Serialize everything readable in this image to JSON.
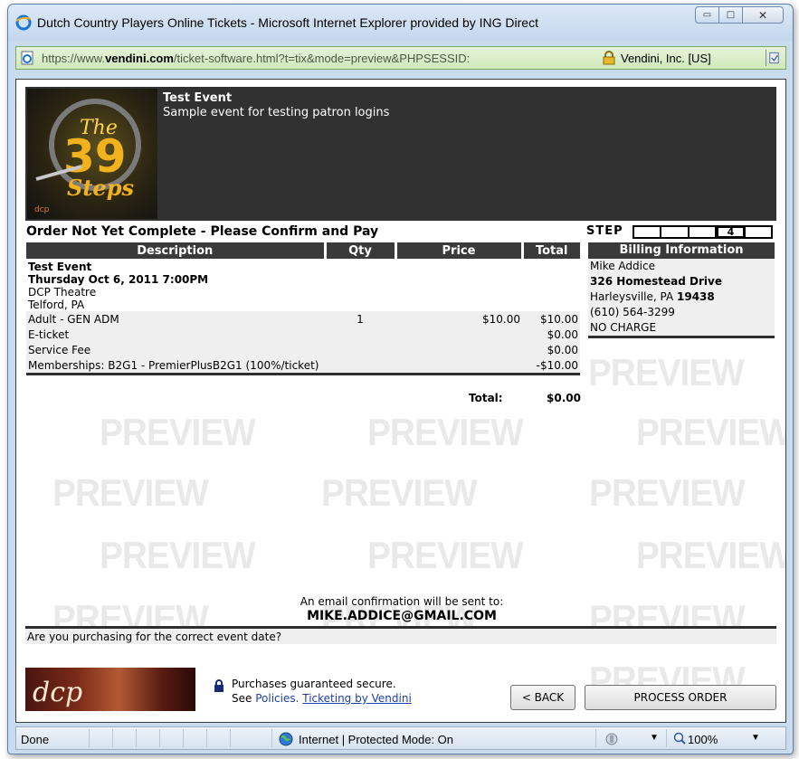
{
  "window": {
    "title": "Dutch Country Players Online Tickets - Microsoft Internet Explorer provided by ING Direct",
    "minimize": "▭",
    "maximize": "□",
    "close": "✕"
  },
  "address": {
    "url_prefix": "https://www.",
    "url_domain": "vendini.com",
    "url_rest": "/ticket-software.html?t=tix&mode=preview&PHPSESSID:",
    "cert": "Vendini, Inc. [US]"
  },
  "event": {
    "name": "Test Event",
    "description": "Sample event for testing patron logins"
  },
  "order": {
    "title": "Order Not Yet Complete - Please Confirm and Pay",
    "step_label": "STEP",
    "current_step": "4",
    "columns": [
      "Description",
      "Qty",
      "Price",
      "Total"
    ],
    "event_info": {
      "name": "Test Event",
      "date": "Thursday Oct 6, 2011 7:00PM",
      "venue": "DCP Theatre",
      "city": "Telford, PA"
    },
    "items": [
      {
        "description": "Adult - GEN ADM",
        "qty": "1",
        "price": "$10.00",
        "total": "$10.00"
      },
      {
        "description": "E-ticket",
        "qty": "",
        "price": "",
        "total": "$0.00"
      },
      {
        "description": "Service Fee",
        "qty": "",
        "price": "",
        "total": "$0.00"
      },
      {
        "description": "Memberships: B2G1 - PremierPlusB2G1 (100%/ticket)",
        "qty": "",
        "price": "",
        "total": "-$10.00"
      }
    ],
    "total_label": "Total:",
    "total_value": "$0.00"
  },
  "billing": {
    "header": "Billing Information",
    "name": "Mike Addice",
    "street": "326 Homestead Drive",
    "city_state": "Harleysville, PA ",
    "zip": "19438",
    "phone": "(610) 564-3299",
    "payment": "NO CHARGE"
  },
  "watermark": "PREVIEW",
  "email": {
    "note": "An email confirmation will be sent to:",
    "address": "MIKE.ADDICE@GMAIL.COM"
  },
  "date_question": "Are you purchasing for the correct event date?",
  "footer": {
    "logo_text": "dcp",
    "secure_text": "Purchases guaranteed secure.",
    "see_text": "See ",
    "policies_link": "Policies.",
    "ticketing_link": "Ticketing by Vendini",
    "back_button": "< BACK",
    "process_button": "PROCESS ORDER"
  },
  "status": {
    "done": "Done",
    "zone": "Internet | Protected Mode: On",
    "zoom": "100%"
  },
  "colors": {
    "header_bg": "#313131",
    "table_header": "#3a3a3a",
    "row_bg": "#efefef",
    "link": "#1e3ea8",
    "address_bar": "#cfe9bb"
  }
}
